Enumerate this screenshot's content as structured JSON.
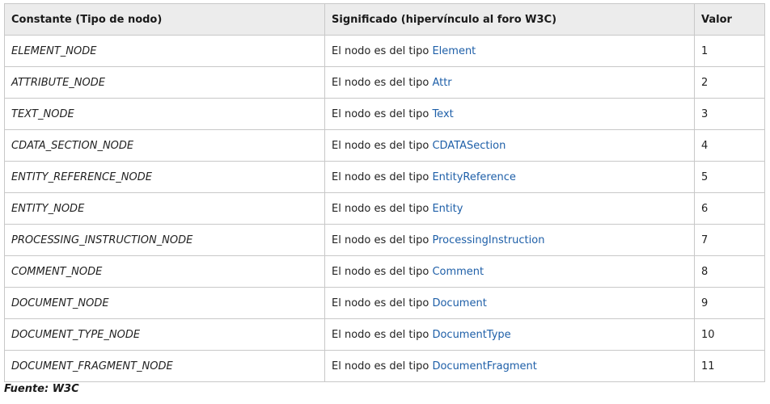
{
  "table": {
    "headers": {
      "constant": "Constante (Tipo de nodo)",
      "meaning": "Significado (hipervínculo al foro W3C)",
      "value": "Valor"
    },
    "meaning_prefix": "El nodo es del tipo",
    "rows": [
      {
        "constant": "ELEMENT_NODE",
        "link": "Element",
        "value": "1"
      },
      {
        "constant": "ATTRIBUTE_NODE",
        "link": "Attr",
        "value": "2"
      },
      {
        "constant": "TEXT_NODE",
        "link": "Text",
        "value": "3"
      },
      {
        "constant": "CDATA_SECTION_NODE",
        "link": "CDATASection",
        "value": "4"
      },
      {
        "constant": "ENTITY_REFERENCE_NODE",
        "link": "EntityReference",
        "value": "5"
      },
      {
        "constant": "ENTITY_NODE",
        "link": "Entity",
        "value": "6"
      },
      {
        "constant": "PROCESSING_INSTRUCTION_NODE",
        "link": "ProcessingInstruction",
        "value": "7"
      },
      {
        "constant": "COMMENT_NODE",
        "link": "Comment",
        "value": "8"
      },
      {
        "constant": "DOCUMENT_NODE",
        "link": "Document",
        "value": "9"
      },
      {
        "constant": "DOCUMENT_TYPE_NODE",
        "link": "DocumentType",
        "value": "10"
      },
      {
        "constant": "DOCUMENT_FRAGMENT_NODE",
        "link": "DocumentFragment",
        "value": "11"
      }
    ]
  },
  "source": "Fuente: W3C",
  "colors": {
    "link": "#1e5fa8",
    "header_bg": "#ececec",
    "border": "#c8c8c8"
  }
}
